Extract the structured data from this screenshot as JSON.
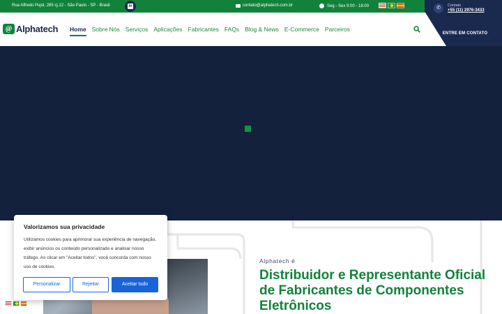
{
  "topbar": {
    "address": "Rua Alfredo Pujol, 285 cj.12 - São Paulo - SP - Brasil",
    "linkedin": "in",
    "email": "contato@alphatech.com.br",
    "hours": "Seg - Sex 9:00 - 18:00",
    "languages": [
      "English",
      "Português",
      "Español"
    ]
  },
  "contact": {
    "label": "Contato",
    "phone": "+55 (11) 2976-3433",
    "cta": "ENTRE EM CONTATO"
  },
  "brand": {
    "mark": "@",
    "name": "Alphatech"
  },
  "nav": {
    "items": [
      {
        "label": "Home",
        "active": true
      },
      {
        "label": "Sobre Nós"
      },
      {
        "label": "Serviços"
      },
      {
        "label": "Aplicações"
      },
      {
        "label": "Fabricantes"
      },
      {
        "label": "FAQs"
      },
      {
        "label": "Blog & News"
      },
      {
        "label": "E-Commerce"
      },
      {
        "label": "Parceiros"
      }
    ],
    "search_icon": "search-icon"
  },
  "intro": {
    "kicker": "Alphatech é",
    "headline": "Distribuidor e Representante Oficial de Fabricantes de Componentes Eletrônicos"
  },
  "cookie": {
    "title": "Valorizamos sua privacidade",
    "text": "Utilizamos cookies para aprimorar sua experiência de navegação, exibir anúncios ou conteúdo personalizado e analisar nosso tráfego. Ao clicar em \"Aceitar todos\", você concorda com nosso uso de cookies.",
    "customize": "Personalizar",
    "reject": "Rejeitar",
    "accept": "Aceitar tudo"
  },
  "colors": {
    "green": "#12823a",
    "navy": "#1a2a4f",
    "hero": "#13213d",
    "cookie_blue": "#1863dc"
  }
}
